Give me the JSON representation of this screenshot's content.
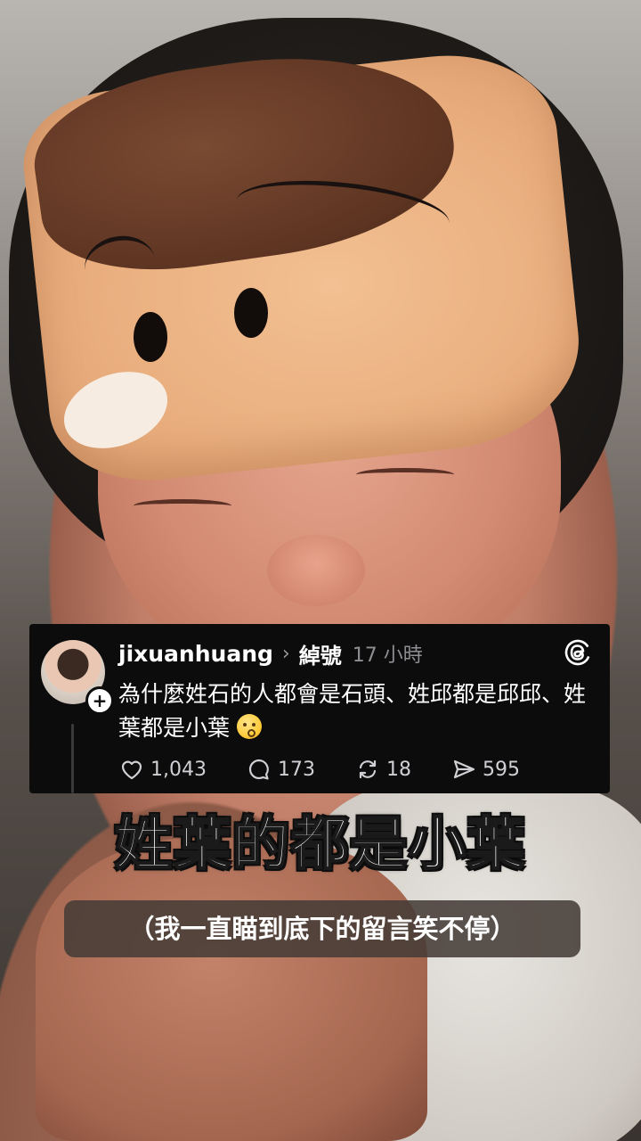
{
  "post": {
    "username": "jixuanhuang",
    "category": "綽號",
    "time": "17 小時",
    "text": "為什麼姓石的人都會是石頭、姓邱都是邱邱、姓葉都是小葉",
    "stats": {
      "likes": "1,043",
      "replies": "173",
      "reposts": "18",
      "shares": "595"
    }
  },
  "captions": {
    "headline": "姓葉的都是小葉",
    "subcaption": "（我一直瞄到底下的留言笑不停）"
  }
}
